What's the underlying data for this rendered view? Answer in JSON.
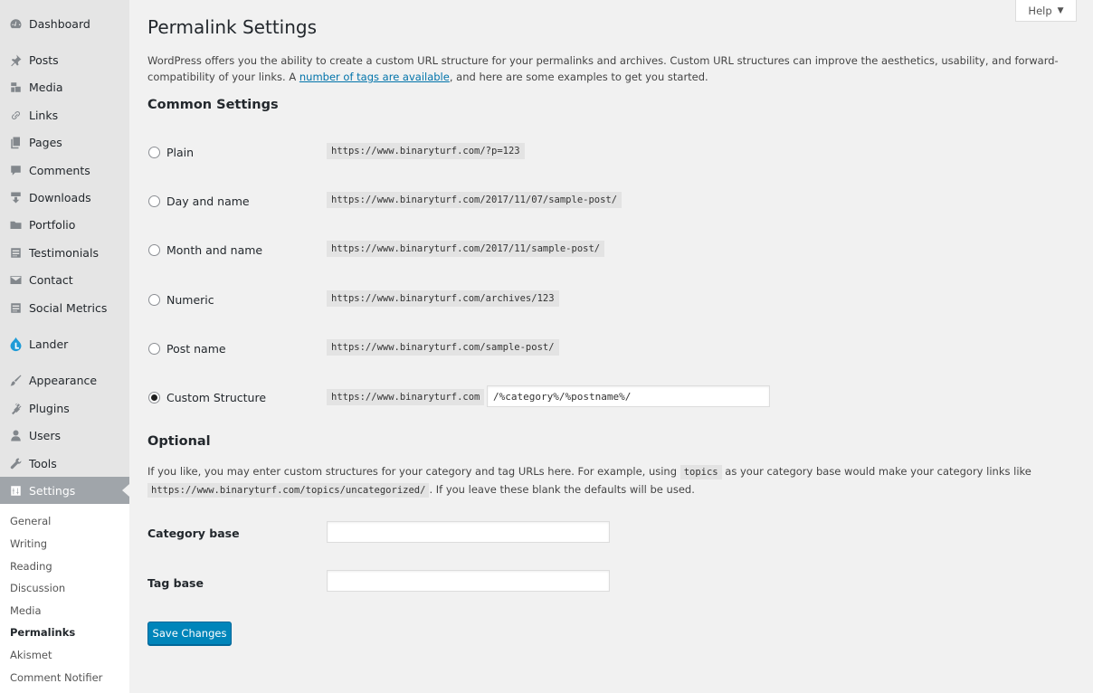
{
  "help": {
    "label": "Help",
    "caret": "▼"
  },
  "menu": [
    {
      "label": "Dashboard",
      "icon": "dashboard-icon"
    },
    {
      "label": "Posts",
      "icon": "pin-icon"
    },
    {
      "label": "Media",
      "icon": "media-icon"
    },
    {
      "label": "Links",
      "icon": "link-icon"
    },
    {
      "label": "Pages",
      "icon": "pages-icon"
    },
    {
      "label": "Comments",
      "icon": "comment-icon"
    },
    {
      "label": "Downloads",
      "icon": "download-icon"
    },
    {
      "label": "Portfolio",
      "icon": "folder-icon"
    },
    {
      "label": "Testimonials",
      "icon": "list-icon"
    },
    {
      "label": "Contact",
      "icon": "mail-icon"
    },
    {
      "label": "Social Metrics",
      "icon": "list-icon"
    },
    {
      "label": "Lander",
      "icon": "lander-icon"
    },
    {
      "label": "Appearance",
      "icon": "brush-icon"
    },
    {
      "label": "Plugins",
      "icon": "plugin-icon"
    },
    {
      "label": "Users",
      "icon": "user-icon"
    },
    {
      "label": "Tools",
      "icon": "wrench-icon"
    },
    {
      "label": "Settings",
      "icon": "settings-icon"
    }
  ],
  "submenu": [
    "General",
    "Writing",
    "Reading",
    "Discussion",
    "Media",
    "Permalinks",
    "Akismet",
    "Comment Notifier"
  ],
  "page": {
    "title": "Permalink Settings",
    "intro_before": "WordPress offers you the ability to create a custom URL structure for your permalinks and archives. Custom URL structures can improve the aesthetics, usability, and forward-compatibility of your links. A ",
    "intro_link": "number of tags are available",
    "intro_after": ", and here are some examples to get you started."
  },
  "common": {
    "heading": "Common Settings",
    "options": [
      {
        "label": "Plain",
        "example": "https://www.binaryturf.com/?p=123",
        "checked": false
      },
      {
        "label": "Day and name",
        "example": "https://www.binaryturf.com/2017/11/07/sample-post/",
        "checked": false
      },
      {
        "label": "Month and name",
        "example": "https://www.binaryturf.com/2017/11/sample-post/",
        "checked": false
      },
      {
        "label": "Numeric",
        "example": "https://www.binaryturf.com/archives/123",
        "checked": false
      },
      {
        "label": "Post name",
        "example": "https://www.binaryturf.com/sample-post/",
        "checked": false
      },
      {
        "label": "Custom Structure",
        "example": "https://www.binaryturf.com",
        "checked": true,
        "value": "/%category%/%postname%/"
      }
    ]
  },
  "optional": {
    "heading": "Optional",
    "desc_1": "If you like, you may enter custom structures for your category and tag URLs here. For example, using ",
    "desc_code_1": "topics",
    "desc_2": " as your category base would make your category links like",
    "desc_code_2": "https://www.binaryturf.com/topics/uncategorized/",
    "desc_3": ". If you leave these blank the defaults will be used.",
    "category_label": "Category base",
    "category_value": "",
    "tag_label": "Tag base",
    "tag_value": ""
  },
  "save_label": "Save Changes"
}
